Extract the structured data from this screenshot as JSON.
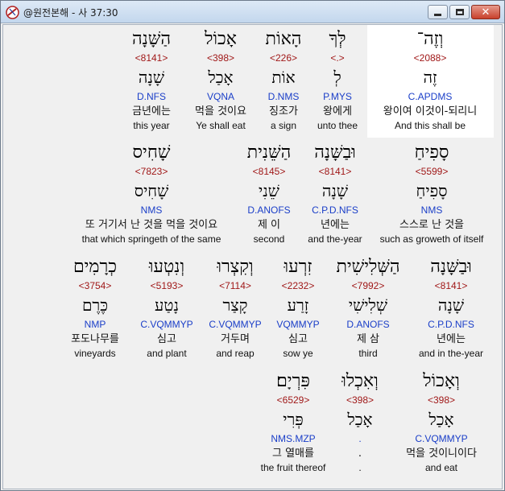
{
  "window": {
    "title": "@원전본해 - 사 37:30",
    "accent": "#c8402c"
  },
  "rows": [
    {
      "words": [
        {
          "heb": "וְזֶה־",
          "strong": "<2088>",
          "lemma": "זֶה",
          "parse": "C.APDMS",
          "kor": "왕이여 이것이-되리니",
          "eng": "And this shall be"
        },
        {
          "heb": "לְּךָ",
          "strong": "<.>",
          "lemma": "לְ",
          "parse": "P.MYS",
          "kor": "왕에게",
          "eng": "unto thee"
        },
        {
          "heb": "הָאוֹת",
          "strong": "<226>",
          "lemma": "אוֹת",
          "parse": "D.NMS",
          "kor": "징조가",
          "eng": "a sign"
        },
        {
          "heb": "אָכוֹל",
          "strong": "<398>",
          "lemma": "אָכַל",
          "parse": "VQNA",
          "kor": "먹을 것이요",
          "eng": "Ye shall eat"
        },
        {
          "heb": "הַשָּׁנָה",
          "strong": "<8141>",
          "lemma": "שָׁנָה",
          "parse": "D.NFS",
          "kor": "금년에는",
          "eng": "this year"
        }
      ]
    },
    {
      "words": [
        {
          "heb": "סָפִיחַ",
          "strong": "<5599>",
          "lemma": "סָפִיחַ",
          "parse": "NMS",
          "kor": "스스로 난 것을",
          "eng": "such as groweth of itself"
        },
        {
          "heb": "וּבַשָּׁנָה",
          "strong": "<8141>",
          "lemma": "שָׁנָה",
          "parse": "C.P.D.NFS",
          "kor": "년에는",
          "eng": "and the-year"
        },
        {
          "heb": "הַשֵּׁנִית",
          "strong": "<8145>",
          "lemma": "שֵׁנִי",
          "parse": "D.ANOFS",
          "kor": "제 이",
          "eng": "second"
        },
        {
          "heb": "שָׁחִיס",
          "strong": "<7823>",
          "lemma": "שָׁחִיס",
          "parse": "NMS",
          "kor": "또 거기서 난 것을 먹을 것이요",
          "eng": "that which springeth of the same"
        }
      ]
    },
    {
      "words": [
        {
          "heb": "וּבַשָּׁנָה",
          "strong": "<8141>",
          "lemma": "שָׁנָה",
          "parse": "C.P.D.NFS",
          "kor": "년에는",
          "eng": "and in the-year"
        },
        {
          "heb": "הַשְּׁלִישִׁית",
          "strong": "<7992>",
          "lemma": "שְׁלִישִׁי",
          "parse": "D.ANOFS",
          "kor": "제 삼",
          "eng": "third"
        },
        {
          "heb": "זִרְעוּ",
          "strong": "<2232>",
          "lemma": "זָרַע",
          "parse": "VQMMYP",
          "kor": "심고",
          "eng": "sow ye"
        },
        {
          "heb": "וְקִצְרוּ",
          "strong": "<7114>",
          "lemma": "קָצַר",
          "parse": "C.VQMMYP",
          "kor": "거두며",
          "eng": "and reap"
        },
        {
          "heb": "וְנִטְעוּ",
          "strong": "<5193>",
          "lemma": "נָטַע",
          "parse": "C.VQMMYP",
          "kor": "심고",
          "eng": "and plant"
        },
        {
          "heb": "כְרָמִים",
          "strong": "<3754>",
          "lemma": "כֶּרֶם",
          "parse": "NMP",
          "kor": "포도나무를",
          "eng": "vineyards"
        }
      ]
    },
    {
      "words": [
        {
          "heb": "וְאָכוֹל",
          "strong": "<398>",
          "lemma": "אָכַל",
          "parse": "C.VQMMYP",
          "kor": "먹을 것이니이다",
          "eng": "and eat"
        },
        {
          "heb": "וְאִכְלוּ",
          "strong": "<398>",
          "lemma": "אָכַל",
          "parse": ".",
          "kor": ".",
          "eng": "."
        },
        {
          "heb": "פִּרְיָם׃",
          "strong": "<6529>",
          "lemma": "פְּרִי",
          "parse": "NMS.MZP",
          "kor": "그 열매를",
          "eng": "the fruit thereof"
        }
      ]
    }
  ]
}
